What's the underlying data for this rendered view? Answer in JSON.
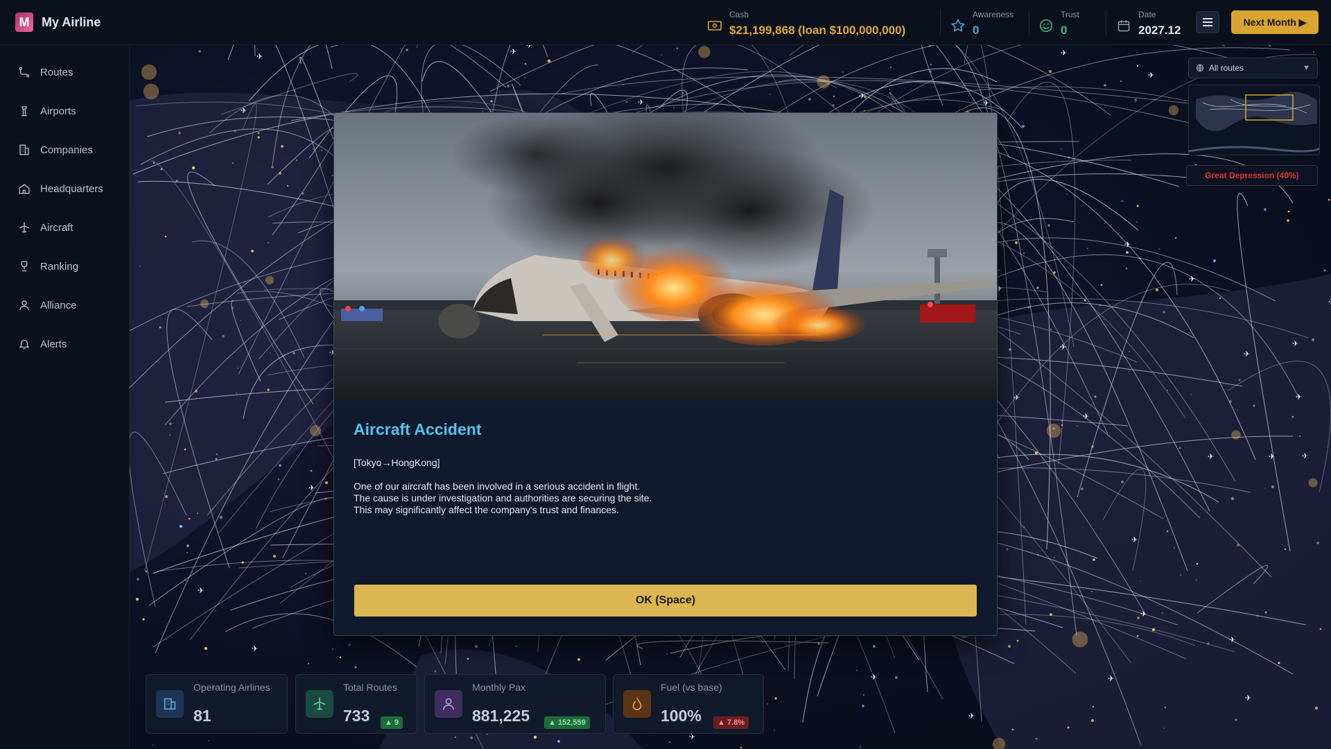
{
  "header": {
    "app_title": "My Airline",
    "logo_letter": "M",
    "cash_label": "Cash",
    "cash_value": "$21,199,868 (loan $100,000,000)",
    "awareness_label": "Awareness",
    "awareness_value": "0",
    "trust_label": "Trust",
    "trust_value": "0",
    "date_label": "Date",
    "date_value": "2027.12",
    "next_month_label": "Next Month ▶"
  },
  "sidebar": {
    "items": [
      {
        "label": "Routes",
        "icon": "route-icon"
      },
      {
        "label": "Airports",
        "icon": "tower-icon"
      },
      {
        "label": "Companies",
        "icon": "building-icon"
      },
      {
        "label": "Headquarters",
        "icon": "home-icon"
      },
      {
        "label": "Aircraft",
        "icon": "plane-icon"
      },
      {
        "label": "Ranking",
        "icon": "trophy-icon"
      },
      {
        "label": "Alliance",
        "icon": "user-icon"
      },
      {
        "label": "Alerts",
        "icon": "bell-icon"
      }
    ]
  },
  "map": {
    "route_filter": "All routes",
    "economy_status": "Great Depression (40%)"
  },
  "kpis": [
    {
      "label": "Operating Airlines",
      "value": "81",
      "badge": ""
    },
    {
      "label": "Total Routes",
      "value": "733",
      "badge": "▲ 9"
    },
    {
      "label": "Monthly Pax",
      "value": "881,225",
      "badge": "▲ 152,559"
    },
    {
      "label": "Fuel (vs base)",
      "value": "100%",
      "badge": "▲ 7.8%"
    }
  ],
  "modal": {
    "title": "Aircraft Accident",
    "route": "[Tokyo→HongKong]",
    "body_lines": [
      "One of our aircraft has been involved in a serious accident in flight.",
      "The cause is under investigation and authorities are securing the site.",
      "This may significantly affect the company's trust and finances."
    ],
    "ok_label": "OK (Space)"
  },
  "colors": {
    "accent_gold": "#d9a530",
    "cash_gold": "#e0a93a",
    "trust_green": "#3fbf7f",
    "awareness_blue": "#4aa8e0",
    "title_cyan": "#56c2f0",
    "danger_red": "#e0342f"
  }
}
